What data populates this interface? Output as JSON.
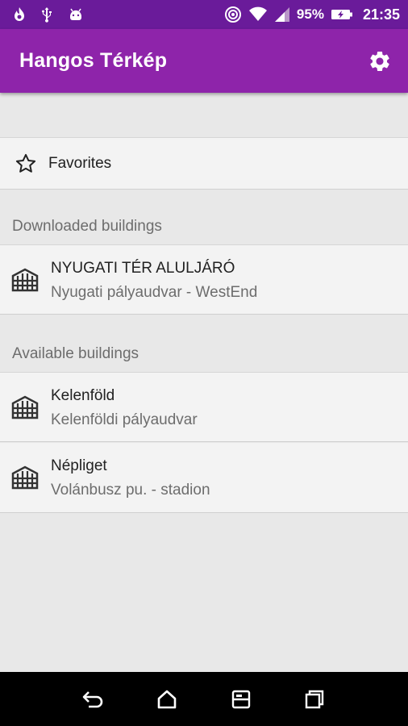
{
  "status_bar": {
    "icons_left": [
      "flame-icon",
      "usb-icon",
      "android-icon"
    ],
    "icons_right": [
      "hotspot-icon",
      "wifi-icon",
      "signal-icon",
      "battery-charging-icon"
    ],
    "battery": "95%",
    "time": "21:35"
  },
  "app_bar": {
    "title": "Hangos Térkép",
    "settings_icon": "gear-icon"
  },
  "favorites": {
    "label": "Favorites",
    "icon": "star-outline-icon"
  },
  "sections": [
    {
      "header": "Downloaded buildings",
      "items": [
        {
          "title": "NYUGATI TÉR ALULJÁRÓ",
          "subtitle": "Nyugati pályaudvar - WestEnd",
          "icon": "building-icon"
        }
      ]
    },
    {
      "header": "Available buildings",
      "items": [
        {
          "title": "Kelenföld",
          "subtitle": "Kelenföldi pályaudvar",
          "icon": "building-icon"
        },
        {
          "title": "Népliget",
          "subtitle": "Volánbusz pu. - stadion",
          "icon": "building-icon"
        }
      ]
    }
  ],
  "nav_bar": {
    "buttons": [
      "back-icon",
      "home-icon",
      "multiwindow-icon",
      "recents-icon"
    ]
  },
  "colors": {
    "status_bar": "#6a1b9a",
    "app_bar": "#8e24aa",
    "background": "#e8e8e8",
    "list_item": "#f3f3f3"
  }
}
